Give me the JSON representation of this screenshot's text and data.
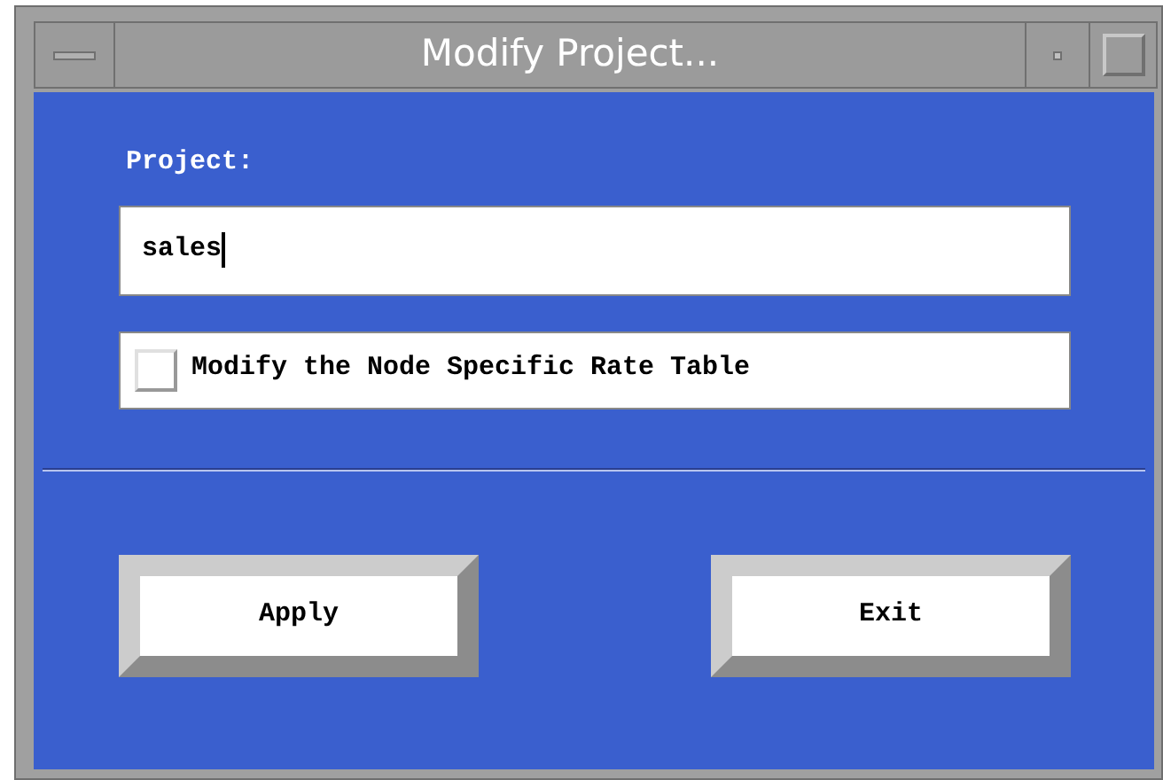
{
  "window": {
    "title": "Modify Project..."
  },
  "project": {
    "label": "Project:",
    "value": "sales"
  },
  "options": [
    {
      "label": "Modify the Node Specific Rate Table",
      "checked": false
    }
  ],
  "buttons": [
    "Apply",
    "Exit"
  ]
}
